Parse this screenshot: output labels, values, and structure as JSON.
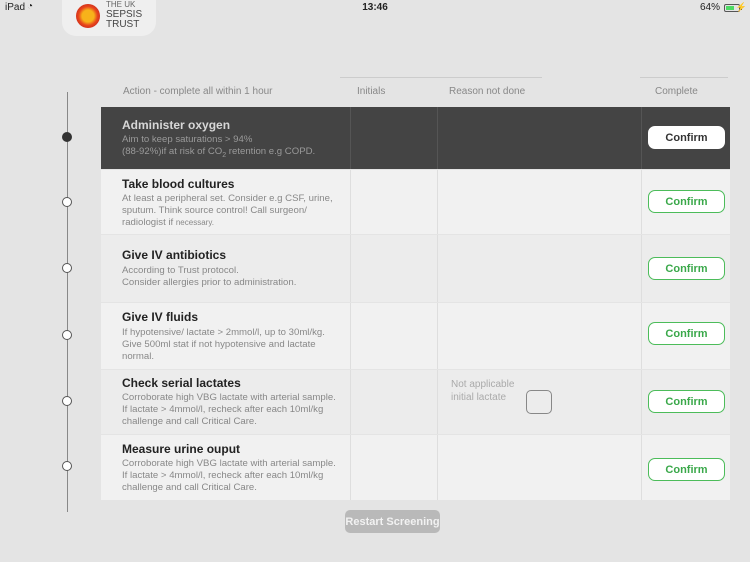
{
  "status_bar": {
    "carrier": "iPad",
    "time": "13:46",
    "battery": "64%",
    "battery_level": 0.64
  },
  "logo": {
    "line1": "THE UK",
    "line2": "SEPSIS",
    "line3": "TRUST"
  },
  "headers": {
    "action": "Action - complete all within 1 hour",
    "initials": "Initials",
    "reason": "Reason not done",
    "complete": "Complete"
  },
  "rows": [
    {
      "title": "Administer oxygen",
      "desc1": "Aim to keep saturations > 94%",
      "desc2": "(88-92%)if at risk of CO",
      "desc2_sub": "2",
      "desc2_rest": " retention e.g COPD.",
      "confirm": "Confirm",
      "state": "active"
    },
    {
      "title": "Take blood cultures",
      "desc1": "At least a peripheral set. Consider e.g CSF, urine,",
      "desc2": "sputum. Think source control! Call surgeon/",
      "desc3": "radiologist if ",
      "desc3_small": "necessary.",
      "confirm": "Confirm"
    },
    {
      "title": "Give IV antibiotics",
      "desc1": "According to Trust protocol.",
      "desc2": "Consider allergies prior to administration.",
      "confirm": "Confirm"
    },
    {
      "title": "Give IV fluids",
      "desc1": "If hypotensive/ lactate > 2mmol/l, up to 30ml/kg.",
      "desc2": "Give 500ml stat if not hypotensive and lactate",
      "desc3": "normal.",
      "confirm": "Confirm"
    },
    {
      "title": "Check serial lactates",
      "desc1": "Corroborate high VBG lactate with arterial sample.",
      "desc2": "If lactate > 4mmol/l, recheck after each 10ml/kg",
      "desc3": "challenge and call Critical Care.",
      "reason_line1": "Not applicable",
      "reason_line2": "initial lactate",
      "confirm": "Confirm"
    },
    {
      "title": "Measure urine ouput",
      "desc1": "Corroborate high VBG lactate with arterial sample.",
      "desc2": "If lactate > 4mmol/l, recheck after each 10ml/kg",
      "desc3": "challenge and call Critical Care.",
      "confirm": "Confirm"
    }
  ],
  "restart_label": "Restart Screening"
}
